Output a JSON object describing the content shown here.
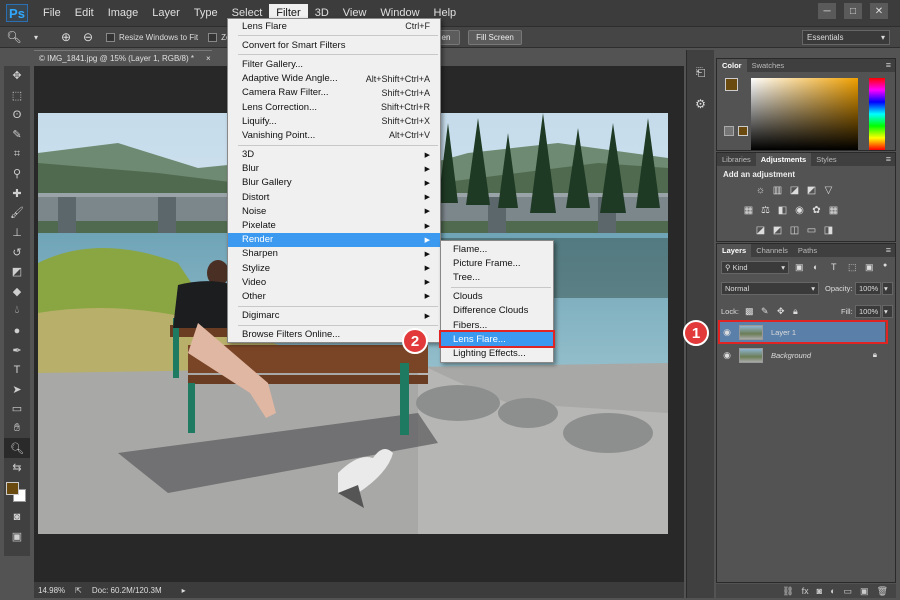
{
  "menubar": {
    "logo": "Ps",
    "items": [
      "File",
      "Edit",
      "Image",
      "Layer",
      "Type",
      "Select",
      "Filter",
      "3D",
      "View",
      "Window",
      "Help"
    ],
    "active": "Filter",
    "window_controls": [
      "minimize-icon",
      "maximize-icon",
      "close-icon"
    ]
  },
  "options": {
    "resize_label": "Resize Windows to Fit",
    "zoom_all_label": "Zo",
    "screen_btn": "en",
    "fill_screen": "Fill Screen",
    "workspace": "Essentials"
  },
  "document": {
    "tab_title": "© IMG_1841.jpg @ 15% (Layer 1, RGB/8) *",
    "zoom": "14.98%",
    "doc_info": "Doc: 60.2M/120.3M"
  },
  "filter_menu": {
    "groups": [
      [
        {
          "label": "Lens Flare",
          "shortcut": "Ctrl+F"
        }
      ],
      [
        {
          "label": "Convert for Smart Filters",
          "shortcut": ""
        }
      ],
      [
        {
          "label": "Filter Gallery...",
          "shortcut": ""
        },
        {
          "label": "Adaptive Wide Angle...",
          "shortcut": "Alt+Shift+Ctrl+A"
        },
        {
          "label": "Camera Raw Filter...",
          "shortcut": "Shift+Ctrl+A"
        },
        {
          "label": "Lens Correction...",
          "shortcut": "Shift+Ctrl+R"
        },
        {
          "label": "Liquify...",
          "shortcut": "Shift+Ctrl+X"
        },
        {
          "label": "Vanishing Point...",
          "shortcut": "Alt+Ctrl+V"
        }
      ],
      [
        {
          "label": "3D",
          "sub": true
        },
        {
          "label": "Blur",
          "sub": true
        },
        {
          "label": "Blur Gallery",
          "sub": true
        },
        {
          "label": "Distort",
          "sub": true
        },
        {
          "label": "Noise",
          "sub": true
        },
        {
          "label": "Pixelate",
          "sub": true
        },
        {
          "label": "Render",
          "sub": true,
          "highlight": true
        },
        {
          "label": "Sharpen",
          "sub": true
        },
        {
          "label": "Stylize",
          "sub": true
        },
        {
          "label": "Video",
          "sub": true
        },
        {
          "label": "Other",
          "sub": true
        }
      ],
      [
        {
          "label": "Digimarc",
          "sub": true
        }
      ],
      [
        {
          "label": "Browse Filters Online...",
          "shortcut": ""
        }
      ]
    ]
  },
  "render_menu": {
    "groups": [
      [
        "Flame...",
        "Picture Frame...",
        "Tree..."
      ],
      [
        "Clouds",
        "Difference Clouds",
        "Fibers...",
        "Lens Flare...",
        "Lighting Effects..."
      ]
    ],
    "highlight": "Lens Flare..."
  },
  "color_panel": {
    "tabs": [
      "Color",
      "Swatches"
    ],
    "fg_color": "#6b4a10"
  },
  "adjustments_panel": {
    "tabs": [
      "Libraries",
      "Adjustments",
      "Styles"
    ],
    "title": "Add an adjustment"
  },
  "layers_panel": {
    "tabs": [
      "Layers",
      "Channels",
      "Paths"
    ],
    "kind": "Kind",
    "blend_mode": "Normal",
    "opacity_label": "Opacity:",
    "opacity": "100%",
    "lock_label": "Lock:",
    "fill_label": "Fill:",
    "fill": "100%",
    "layers": [
      {
        "name": "Layer 1",
        "selected": true
      },
      {
        "name": "Background",
        "locked": true
      }
    ]
  },
  "annotations": {
    "marker1": "1",
    "marker2": "2",
    "marker_color": "#e23a3a"
  }
}
